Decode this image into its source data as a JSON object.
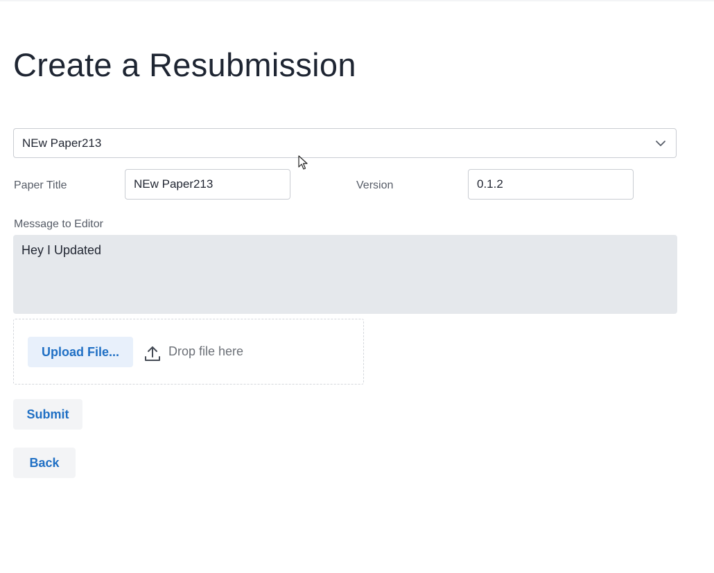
{
  "page": {
    "title": "Create a Resubmission"
  },
  "paper_select": {
    "selected": "NEw Paper213",
    "icon": "chevron-down-icon"
  },
  "form": {
    "paper_title_label": "Paper Title",
    "paper_title_value": "NEw Paper213",
    "version_label": "Version",
    "version_value": "0.1.2",
    "message_label": "Message to Editor",
    "message_value": "Hey I Updated"
  },
  "upload": {
    "button_label": "Upload File...",
    "drop_text": "Drop file here",
    "icon": "upload-icon"
  },
  "actions": {
    "submit_label": "Submit",
    "back_label": "Back"
  },
  "colors": {
    "accent": "#1f6fc4",
    "textarea_bg": "#e5e8ec",
    "upload_bg": "#e8f0fb",
    "button_bg": "#f3f4f6"
  }
}
